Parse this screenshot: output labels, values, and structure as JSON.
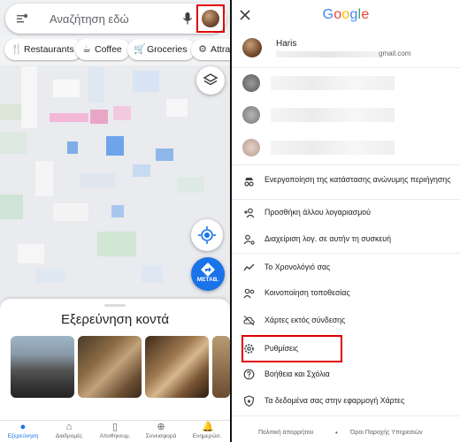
{
  "search": {
    "placeholder": "Αναζήτηση εδώ"
  },
  "chips": [
    {
      "label": "Restaurants",
      "icon": "fork-knife-icon"
    },
    {
      "label": "Coffee",
      "icon": "coffee-cup-icon"
    },
    {
      "label": "Groceries",
      "icon": "shopping-cart-icon"
    },
    {
      "label": "Attrac",
      "icon": "attraction-icon"
    }
  ],
  "map_buttons": {
    "go_label": "ΜΕΤΑΒ."
  },
  "explore": {
    "title": "Εξερεύνηση κοντά"
  },
  "bottom_nav": [
    {
      "label": "Εξερεύνηση",
      "icon": "location-pin-icon",
      "active": true
    },
    {
      "label": "Διαδρομές",
      "icon": "commute-icon",
      "active": false
    },
    {
      "label": "Αποθηκευμ.",
      "icon": "bookmark-icon",
      "active": false
    },
    {
      "label": "Συνεισφορά",
      "icon": "plus-circle-icon",
      "active": false
    },
    {
      "label": "Ενημερώσ.",
      "icon": "bell-icon",
      "active": false
    }
  ],
  "account_menu": {
    "brand": "Google",
    "account": {
      "name": "Haris",
      "email_suffix": "gmail.com"
    },
    "items": [
      {
        "label": "Ενεργοποίηση της κατάστασης ανώνυμης περιήγησης",
        "icon": "incognito-icon"
      },
      {
        "label": "Προσθήκη άλλου λογαριασμού",
        "icon": "add-person-icon"
      },
      {
        "label": "Διαχείριση λογ. σε αυτήν τη συσκευή",
        "icon": "manage-accounts-icon"
      },
      {
        "label": "Το Χρονολόγιό σας",
        "icon": "timeline-icon"
      },
      {
        "label": "Κοινοποίηση τοποθεσίας",
        "icon": "share-location-icon"
      },
      {
        "label": "Χάρτες εκτός σύνδεσης",
        "icon": "offline-cloud-icon"
      },
      {
        "label": "Ρυθμίσεις",
        "icon": "gear-icon"
      },
      {
        "label": "Βοήθεια και Σχόλια",
        "icon": "help-icon"
      },
      {
        "label": "Τα δεδομένα σας στην εφαρμογή Χάρτες",
        "icon": "data-shield-icon"
      }
    ],
    "footer": {
      "privacy": "Πολιτική απορρήτου",
      "separator": "•",
      "terms": "Όροι Παροχής Υπηρεσιών"
    }
  },
  "colors": {
    "accent": "#1a73e8",
    "highlight": "#e00000"
  }
}
